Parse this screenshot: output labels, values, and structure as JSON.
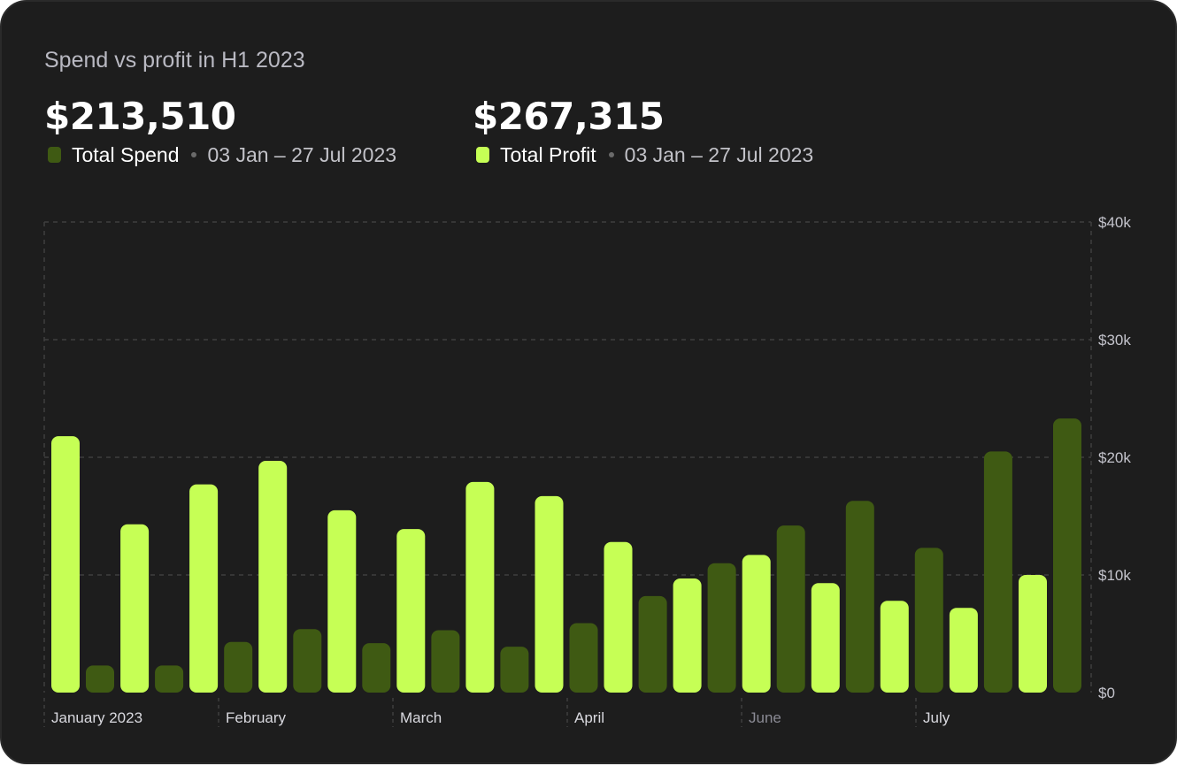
{
  "colors": {
    "spend": "#3f5a13",
    "profit": "#c6ff55",
    "background": "#1d1d1d",
    "grid": "#3e3e3e"
  },
  "chart_title": "Spend vs profit in H1 2023",
  "kpis": {
    "spend": {
      "value": "$213,510",
      "label": "Total Spend",
      "range": "03 Jan – 27 Jul 2023"
    },
    "profit": {
      "value": "$267,315",
      "label": "Total Profit",
      "range": "03 Jan – 27 Jul 2023"
    }
  },
  "chart_data": {
    "type": "bar",
    "title": "Spend vs profit in H1 2023",
    "ylim": [
      0,
      40000
    ],
    "y_ticks": [
      "$0",
      "$10k",
      "$20k",
      "$30k",
      "$40k"
    ],
    "y_tick_values": [
      0,
      10000,
      20000,
      30000,
      40000
    ],
    "x_month_labels": [
      {
        "label": "January 2023",
        "dim": false
      },
      {
        "label": "February",
        "dim": false
      },
      {
        "label": "March",
        "dim": false
      },
      {
        "label": "April",
        "dim": false
      },
      {
        "label": "June",
        "dim": true
      },
      {
        "label": "July",
        "dim": false
      }
    ],
    "grid": true,
    "legend": "top-left",
    "series": [
      {
        "name": "Total Spend",
        "color": "#3f5a13"
      },
      {
        "name": "Total Profit",
        "color": "#c6ff55"
      }
    ],
    "bars": [
      {
        "series": "Total Profit",
        "value": 21800
      },
      {
        "series": "Total Spend",
        "value": 2300
      },
      {
        "series": "Total Profit",
        "value": 14300
      },
      {
        "series": "Total Spend",
        "value": 2300
      },
      {
        "series": "Total Profit",
        "value": 17700
      },
      {
        "series": "Total Spend",
        "value": 4300
      },
      {
        "series": "Total Profit",
        "value": 19700
      },
      {
        "series": "Total Spend",
        "value": 5400
      },
      {
        "series": "Total Profit",
        "value": 15500
      },
      {
        "series": "Total Spend",
        "value": 4200
      },
      {
        "series": "Total Profit",
        "value": 13900
      },
      {
        "series": "Total Spend",
        "value": 5300
      },
      {
        "series": "Total Profit",
        "value": 17900
      },
      {
        "series": "Total Spend",
        "value": 3900
      },
      {
        "series": "Total Profit",
        "value": 16700
      },
      {
        "series": "Total Spend",
        "value": 5900
      },
      {
        "series": "Total Profit",
        "value": 12800
      },
      {
        "series": "Total Spend",
        "value": 8200
      },
      {
        "series": "Total Profit",
        "value": 9700
      },
      {
        "series": "Total Spend",
        "value": 11000
      },
      {
        "series": "Total Profit",
        "value": 11700
      },
      {
        "series": "Total Spend",
        "value": 14200
      },
      {
        "series": "Total Profit",
        "value": 9300
      },
      {
        "series": "Total Spend",
        "value": 16300
      },
      {
        "series": "Total Profit",
        "value": 7800
      },
      {
        "series": "Total Spend",
        "value": 12300
      },
      {
        "series": "Total Profit",
        "value": 7200
      },
      {
        "series": "Total Spend",
        "value": 20500
      },
      {
        "series": "Total Profit",
        "value": 10000
      },
      {
        "series": "Total Spend",
        "value": 23300
      }
    ]
  }
}
